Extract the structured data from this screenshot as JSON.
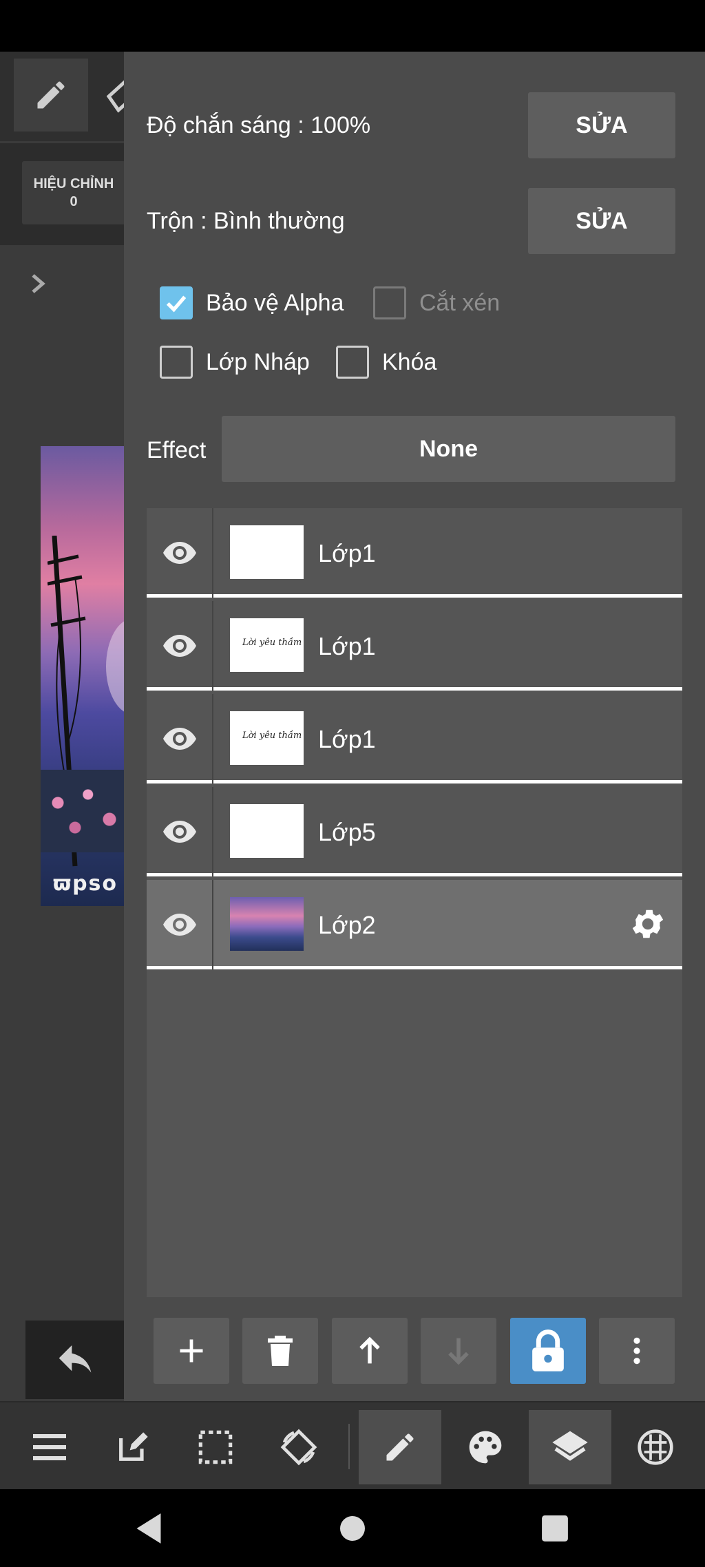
{
  "background_app": {
    "adjust_label": "HIỆU CHỈNH",
    "adjust_value": "0",
    "watermark": "ϖpso"
  },
  "layer_panel": {
    "opacity_label": "Độ chắn sáng : 100%",
    "opacity_edit": "SỬA",
    "blend_label": "Trộn : Bình thường",
    "blend_edit": "SỬA",
    "checkboxes": [
      {
        "label": "Bảo vệ Alpha",
        "checked": true,
        "enabled": true
      },
      {
        "label": "Cắt xén",
        "checked": false,
        "enabled": false
      },
      {
        "label": "Lớp Nháp",
        "checked": false,
        "enabled": true
      },
      {
        "label": "Khóa",
        "checked": false,
        "enabled": true
      }
    ],
    "effect_label": "Effect",
    "effect_value": "None",
    "layers": [
      {
        "name": "Lớp1",
        "thumb": "blank",
        "visible": true,
        "selected": false
      },
      {
        "name": "Lớp1",
        "thumb": "script",
        "thumb_text": "Lời yêu thầm",
        "visible": true,
        "selected": false
      },
      {
        "name": "Lớp1",
        "thumb": "script",
        "thumb_text": "Lời yêu thầm",
        "visible": true,
        "selected": false
      },
      {
        "name": "Lớp5",
        "thumb": "blank",
        "visible": true,
        "selected": false
      },
      {
        "name": "Lớp2",
        "thumb": "scene",
        "visible": true,
        "selected": true
      }
    ],
    "actions": [
      "add-icon",
      "trash-icon",
      "arrow-up-icon",
      "arrow-down-icon",
      "lock-icon",
      "more-vert-icon"
    ]
  },
  "bottom_nav": {
    "items": [
      "menu-icon",
      "edit-icon",
      "selection-icon",
      "rotate-icon",
      "brush-icon",
      "palette-icon",
      "layers-icon",
      "grid-icon"
    ],
    "active": [
      "brush-icon",
      "layers-icon"
    ]
  },
  "colors": {
    "panel_bg": "#4b4b4b",
    "accent_blue": "#4a8ec7",
    "checkbox_checked": "#6fc2ec"
  }
}
